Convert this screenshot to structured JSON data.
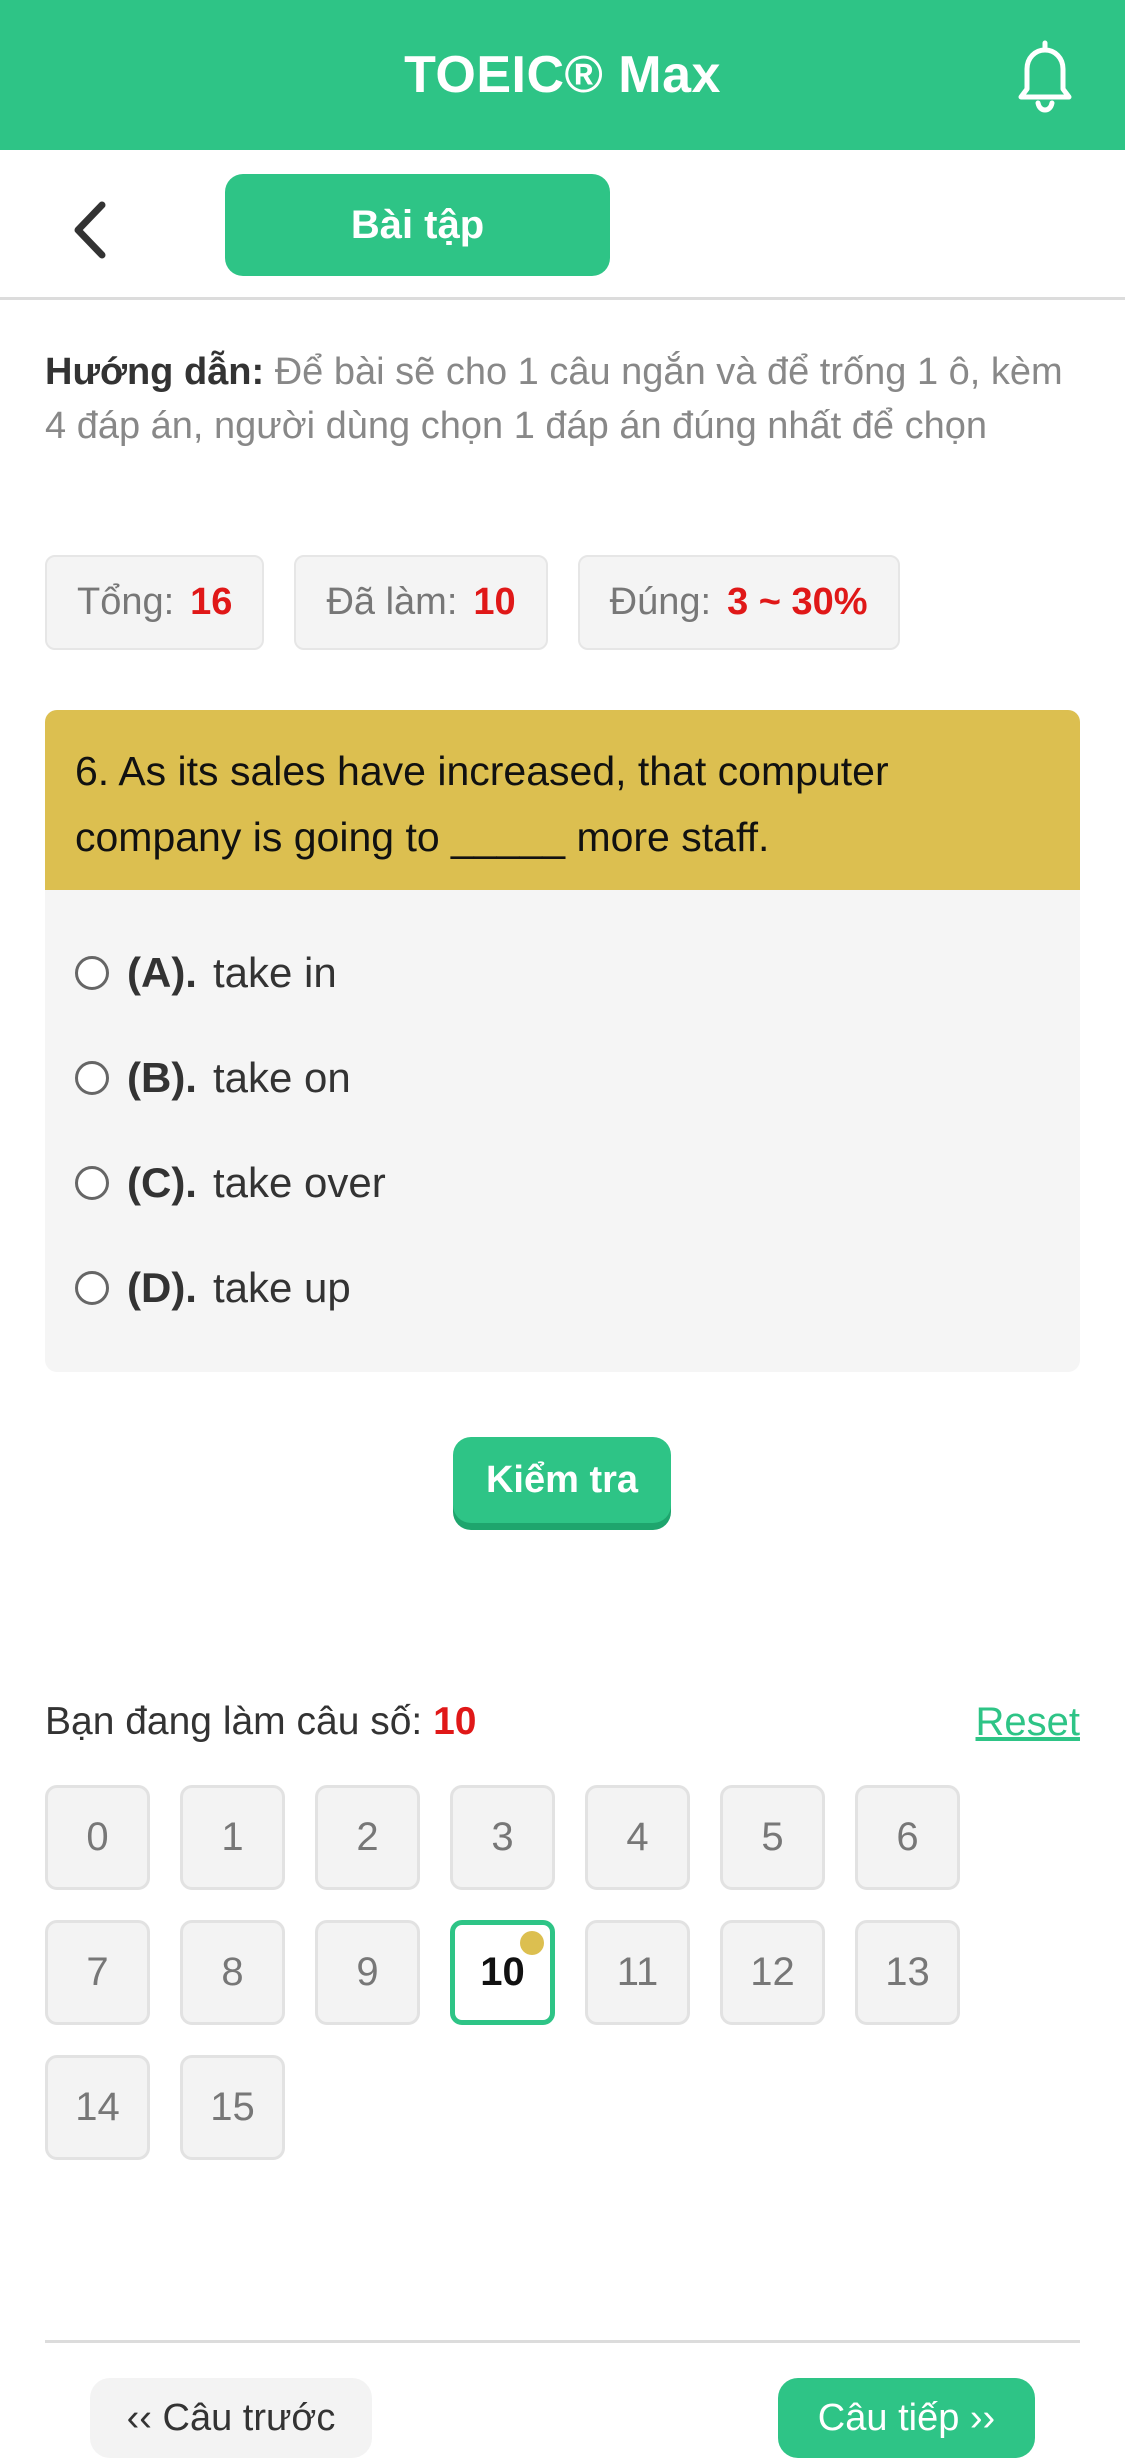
{
  "header": {
    "title": "TOEIC® Max",
    "bell_icon": "bell-icon"
  },
  "subheader": {
    "back_icon": "chevron-left-icon",
    "tab_label": "Bài tập"
  },
  "instructions": {
    "label": "Hướng dẫn:",
    "text": " Để bài sẽ cho 1 câu ngắn và để trống 1 ô, kèm 4 đáp án, người dùng chọn 1 đáp án đúng nhất để chọn"
  },
  "stats": {
    "total_label": "Tổng:",
    "total_value": "16",
    "done_label": "Đã làm:",
    "done_value": "10",
    "correct_label": "Đúng:",
    "correct_value": "3 ~ 30%"
  },
  "question": {
    "text": "6. As its sales have increased, that computer company is going to _____ more staff.",
    "options": [
      {
        "letter": "(A).",
        "text": "take in"
      },
      {
        "letter": "(B).",
        "text": "take on"
      },
      {
        "letter": "(C).",
        "text": "take over"
      },
      {
        "letter": "(D).",
        "text": "take up"
      }
    ]
  },
  "check_button": "Kiểm tra",
  "progress": {
    "label": "Bạn đang làm câu số: ",
    "current": "10",
    "reset_label": "Reset",
    "numbers": [
      "0",
      "1",
      "2",
      "3",
      "4",
      "5",
      "6",
      "7",
      "8",
      "9",
      "10",
      "11",
      "12",
      "13",
      "14",
      "15"
    ],
    "current_index": 10
  },
  "footer": {
    "prev_label": "‹‹ Câu trước",
    "next_label": "Câu tiếp ››"
  },
  "colors": {
    "brand": "#2ec486",
    "question_bg": "#dcbf50",
    "highlight_red": "#e01818"
  }
}
